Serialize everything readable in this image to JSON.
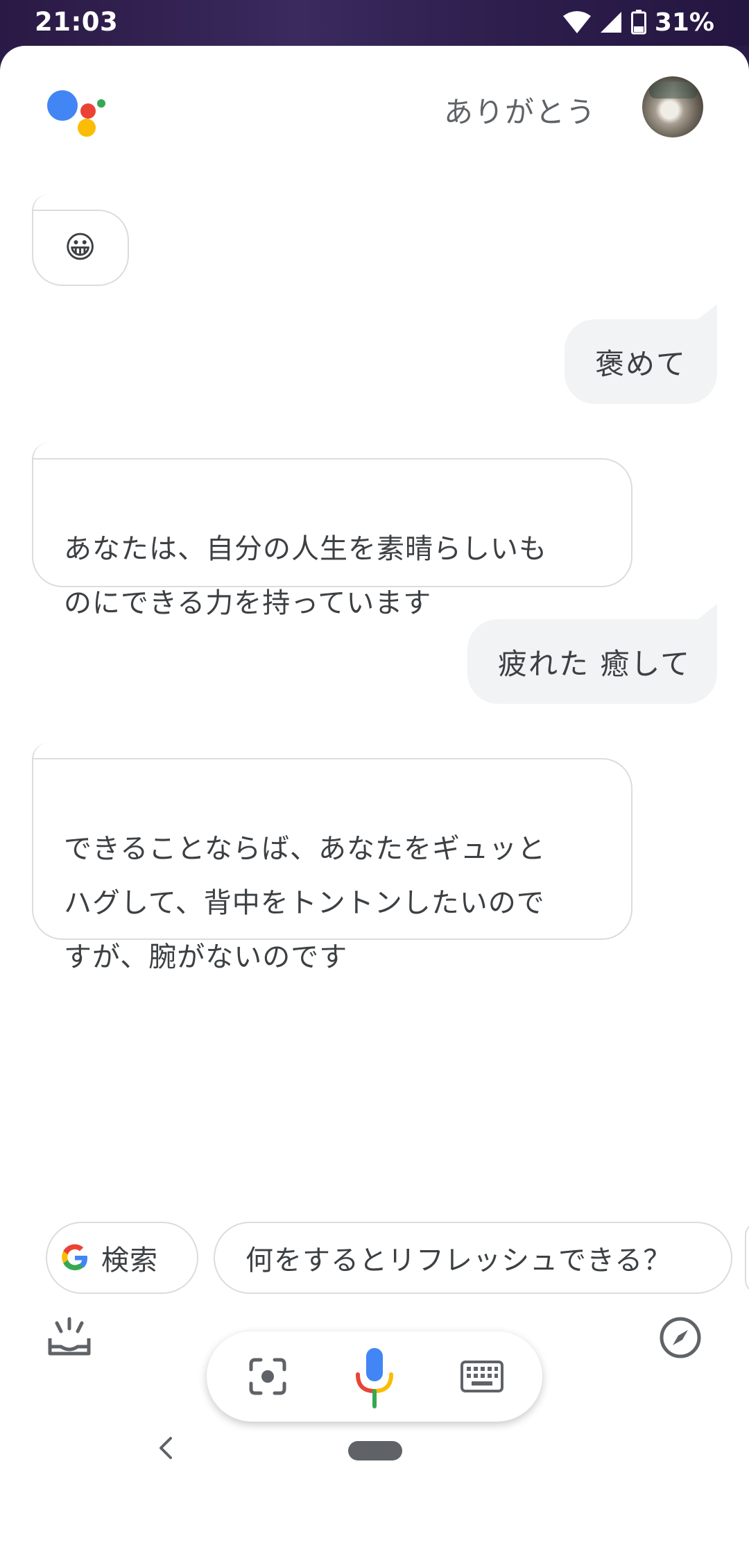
{
  "status_bar": {
    "time": "21:03",
    "battery": "31%"
  },
  "header": {
    "query": "ありがとう"
  },
  "conversation": {
    "assistant_1": "😀",
    "user_1": "褒めて",
    "assistant_2": "あなたは、自分の人生を素晴らしいも\nのにできる力を持っています",
    "user_2": "疲れた 癒して",
    "assistant_3": "できることならば、あなたをギュッと\nハグして、背中をトントンしたいので\nすが、腕がないのです"
  },
  "chips": {
    "search_label": "検索",
    "suggestion": "何をするとリフレッシュできる？"
  },
  "colors": {
    "google_blue": "#4285F4",
    "google_red": "#EA4335",
    "google_yellow": "#FBBC05",
    "google_green": "#34A853"
  }
}
